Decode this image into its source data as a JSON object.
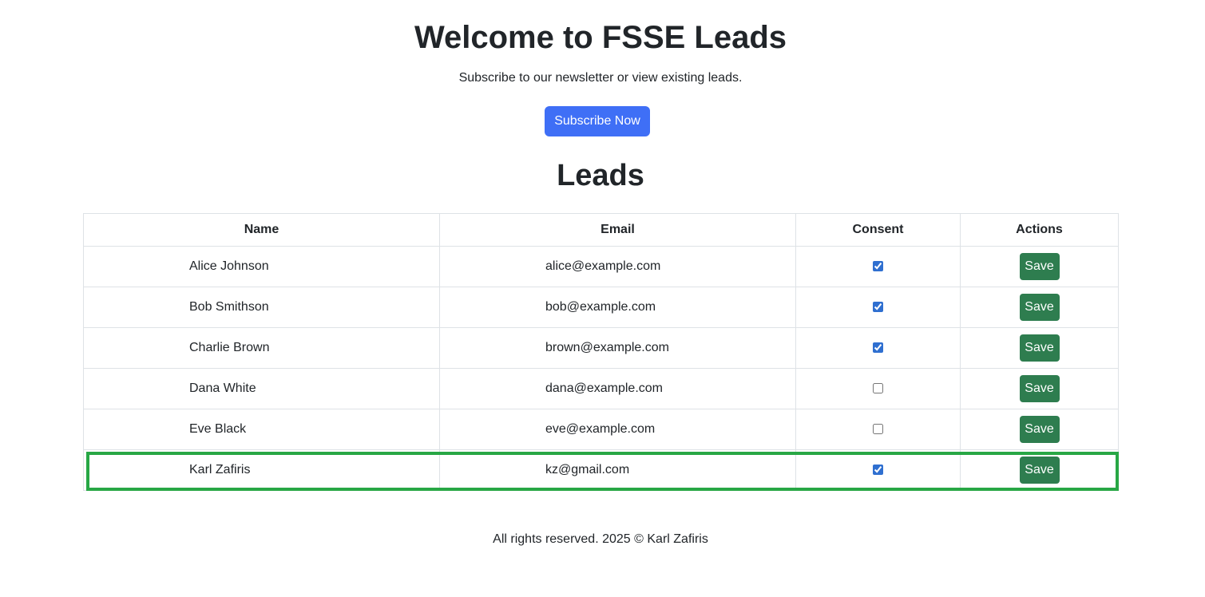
{
  "header": {
    "title": "Welcome to FSSE Leads",
    "subtitle": "Subscribe to our newsletter or view existing leads.",
    "subscribe_label": "Subscribe Now",
    "subscribe_color": "#3f6ff6"
  },
  "leads": {
    "title": "Leads",
    "columns": [
      "Name",
      "Email",
      "Consent",
      "Actions"
    ],
    "rows": [
      {
        "name": "Alice Johnson",
        "email": "alice@example.com",
        "consent": true,
        "action": "Save"
      },
      {
        "name": "Bob Smithson",
        "email": "bob@example.com",
        "consent": true,
        "action": "Save"
      },
      {
        "name": "Charlie Brown",
        "email": "brown@example.com",
        "consent": true,
        "action": "Save"
      },
      {
        "name": "Dana White",
        "email": "dana@example.com",
        "consent": false,
        "action": "Save"
      },
      {
        "name": "Eve Black",
        "email": "eve@example.com",
        "consent": false,
        "action": "Save"
      },
      {
        "name": "Karl Zafiris",
        "email": "kz@gmail.com",
        "consent": true,
        "action": "Save",
        "highlighted": true
      }
    ],
    "save_color": "#2e7d4f",
    "highlight_color": "#28a745"
  },
  "footer": {
    "text": "All rights reserved. 2025 © Karl Zafiris"
  }
}
